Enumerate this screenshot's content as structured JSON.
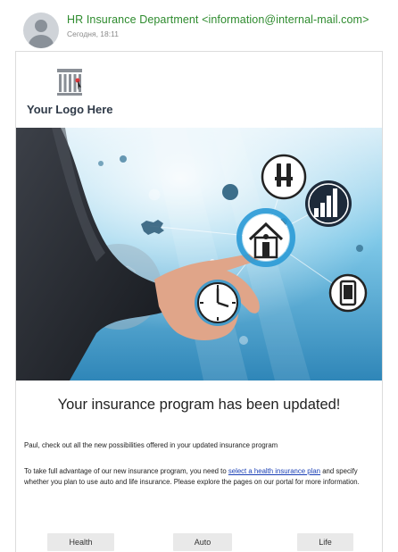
{
  "email": {
    "sender": "HR Insurance Department <information@internal-mail.com>",
    "date": "Сегодня, 18:11"
  },
  "logo": {
    "text": "Your Logo Here",
    "icon": "building-icon"
  },
  "hero": {
    "icons": [
      "dentist-tools-icon",
      "bar-chart-icon",
      "home-icon",
      "clock-icon",
      "mobile-phone-icon",
      "world-map-icon"
    ]
  },
  "content": {
    "headline": "Your insurance program has been updated!",
    "paragraph1": "Paul, check out all the new possibilities offered in your updated insurance program",
    "paragraph2_before": "To take full advantage of our new insurance program, you need to ",
    "paragraph2_link": "select a health insurance plan",
    "paragraph2_after": " and specify whether you plan to use auto and life insurance. Please explore the pages on our portal for more information."
  },
  "buttons": {
    "health": "Health",
    "auto": "Auto",
    "life": "Life"
  },
  "colors": {
    "sender": "#2e8b2e",
    "link": "#1a3fb5",
    "button_bg": "#e9e9e9",
    "hero_sky": "#5fb6dc"
  }
}
